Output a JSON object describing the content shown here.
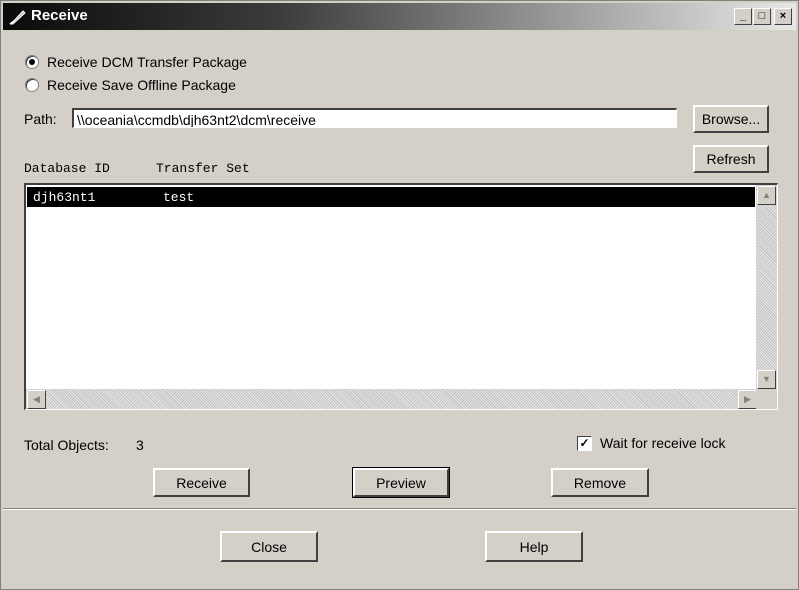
{
  "window": {
    "title": "Receive",
    "buttons": {
      "minimize": "_",
      "maximize": "□",
      "close": "×"
    }
  },
  "options": {
    "transfer_package": {
      "label": "Receive DCM Transfer Package",
      "checked": true
    },
    "offline_package": {
      "label": "Receive Save Offline Package",
      "checked": false
    }
  },
  "path": {
    "label": "Path:",
    "value": "\\\\oceania\\ccmdb\\djh63nt2\\dcm\\receive"
  },
  "browse_label": "Browse...",
  "refresh_label": "Refresh",
  "columns": [
    "Database ID",
    "Transfer Set"
  ],
  "rows": [
    {
      "database_id": "djh63nt1",
      "transfer_set": "test"
    }
  ],
  "total_objects": {
    "label": "Total Objects:",
    "value": "3"
  },
  "wait_lock": {
    "label": "Wait for receive lock",
    "checked": true
  },
  "actions": {
    "receive": "Receive",
    "preview": "Preview",
    "remove": "Remove"
  },
  "footer": {
    "close": "Close",
    "help": "Help"
  },
  "icons": {
    "title": "feather-pen-icon",
    "scroll_up": "arrow-up-icon",
    "scroll_down": "arrow-down-icon",
    "scroll_left": "arrow-left-icon",
    "scroll_right": "arrow-right-icon",
    "check": "check-icon"
  }
}
